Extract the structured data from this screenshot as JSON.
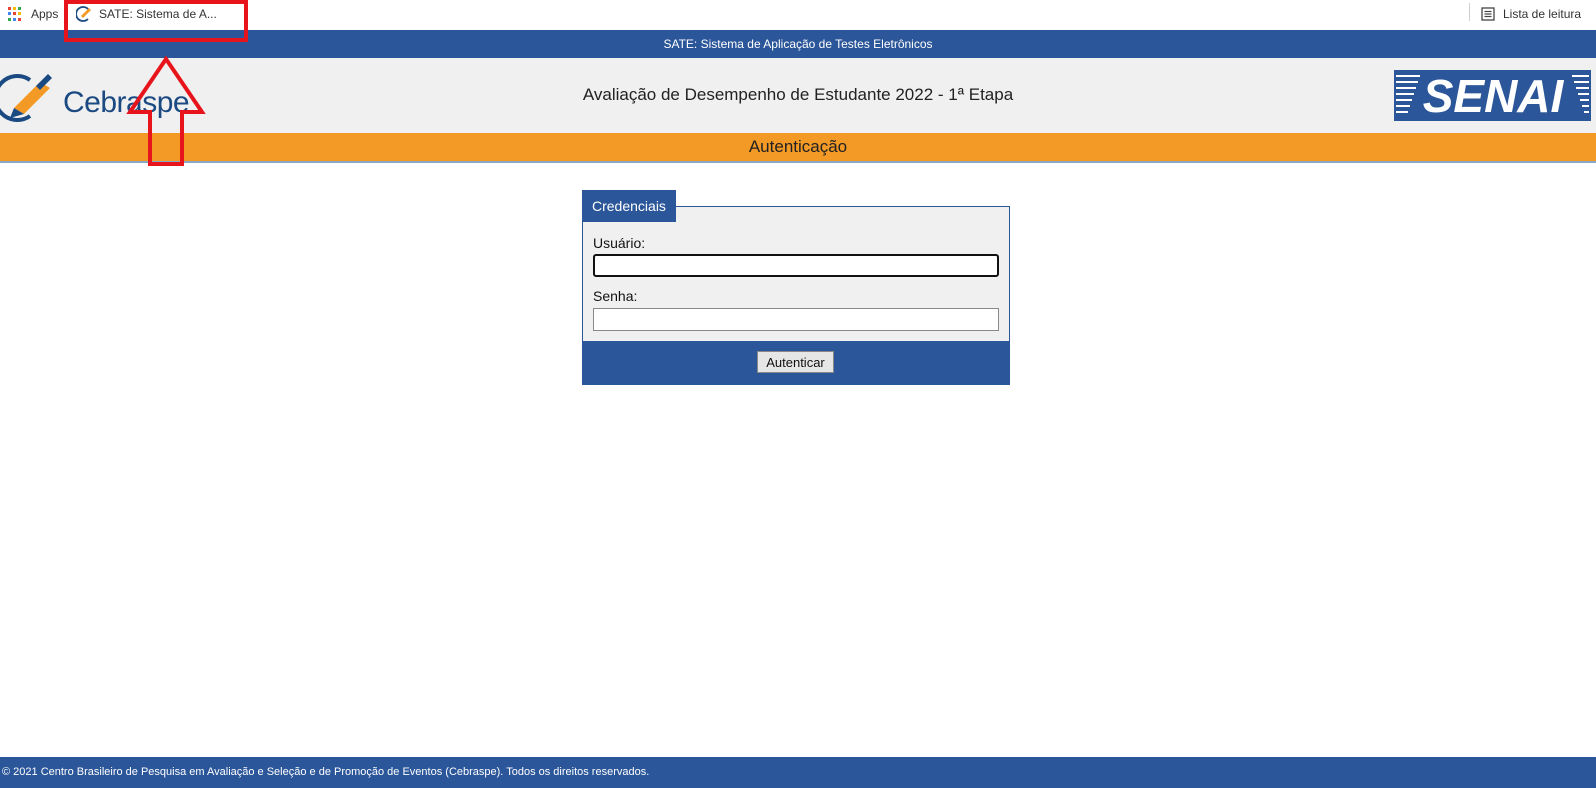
{
  "bookmarks": {
    "apps_label": "Apps",
    "tab_label": "SATE: Sistema de A...",
    "reading_list_label": "Lista de leitura"
  },
  "topbar": {
    "title": "SATE: Sistema de Aplicação de Testes Eletrônicos"
  },
  "header": {
    "logo_left": "Cebraspe",
    "title": "Avaliação de Desempenho de Estudante 2022 - 1ª Etapa",
    "logo_right": "SENAI"
  },
  "section": {
    "title": "Autenticação"
  },
  "form": {
    "legend": "Credenciais",
    "user_label": "Usuário:",
    "user_value": "",
    "password_label": "Senha:",
    "password_value": "",
    "submit_label": "Autenticar"
  },
  "footer": {
    "text": "© 2021 Centro Brasileiro de Pesquisa em Avaliação e Seleção e de Promoção de Eventos (Cebraspe). Todos os direitos reservados."
  },
  "colors": {
    "primary": "#2b5699",
    "accent": "#f39a26",
    "annotation": "#e8141c"
  },
  "icons": [
    "apps-grid-icon",
    "cebraspe-favicon-icon",
    "reading-list-icon"
  ]
}
